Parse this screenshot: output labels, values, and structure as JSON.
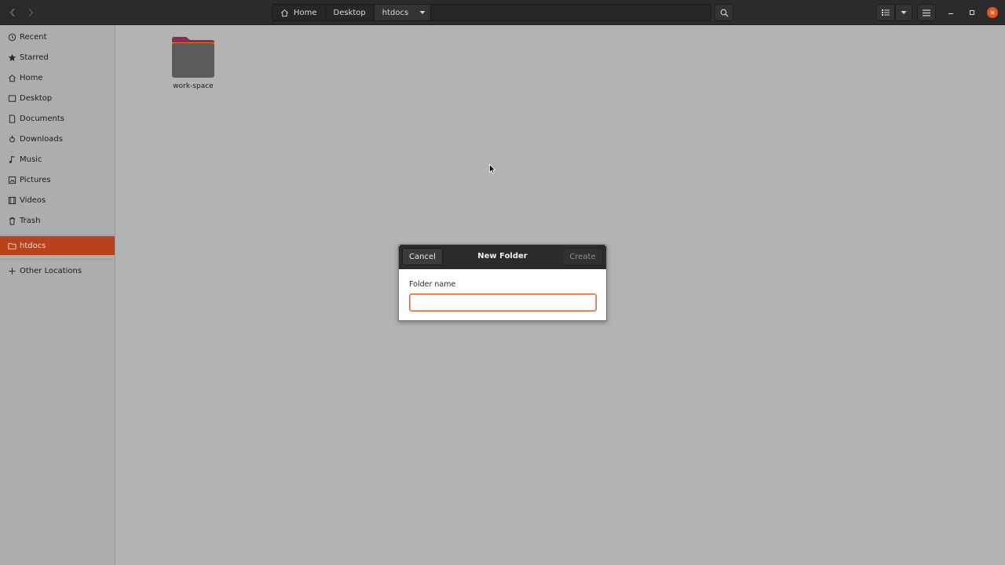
{
  "header": {
    "back_icon": "chevron-left-icon",
    "forward_icon": "chevron-right-icon",
    "breadcrumbs": [
      {
        "label": "Home",
        "icon": "home-icon"
      },
      {
        "label": "Desktop"
      },
      {
        "label": "htdocs"
      }
    ],
    "search_icon": "search-icon",
    "view_icon": "list-view-icon",
    "view_menu_icon": "chevron-down-icon",
    "menu_icon": "hamburger-menu-icon",
    "window_controls": [
      "minimize-icon",
      "maximize-icon",
      "close-icon"
    ],
    "colors": {
      "close": "#e95420"
    }
  },
  "sidebar": {
    "items": [
      {
        "label": "Recent",
        "icon": "clock-icon"
      },
      {
        "label": "Starred",
        "icon": "star-icon"
      },
      {
        "label": "Home",
        "icon": "home-icon"
      },
      {
        "label": "Desktop",
        "icon": "desktop-icon"
      },
      {
        "label": "Documents",
        "icon": "document-icon"
      },
      {
        "label": "Downloads",
        "icon": "download-icon"
      },
      {
        "label": "Music",
        "icon": "music-icon"
      },
      {
        "label": "Pictures",
        "icon": "picture-icon"
      },
      {
        "label": "Videos",
        "icon": "video-icon"
      },
      {
        "label": "Trash",
        "icon": "trash-icon"
      }
    ],
    "bookmarks": [
      {
        "label": "htdocs",
        "icon": "folder-icon",
        "selected": true
      }
    ],
    "other": {
      "label": "Other Locations",
      "icon": "plus-icon"
    },
    "colors": {
      "selected": "#b7421b"
    }
  },
  "files": [
    {
      "name": "work-space",
      "icon": "folder-icon"
    }
  ],
  "dialog": {
    "title": "New Folder",
    "cancel_label": "Cancel",
    "create_label": "Create",
    "field_label": "Folder name",
    "field_value": "",
    "colors": {
      "focus": "#e0662f"
    }
  }
}
